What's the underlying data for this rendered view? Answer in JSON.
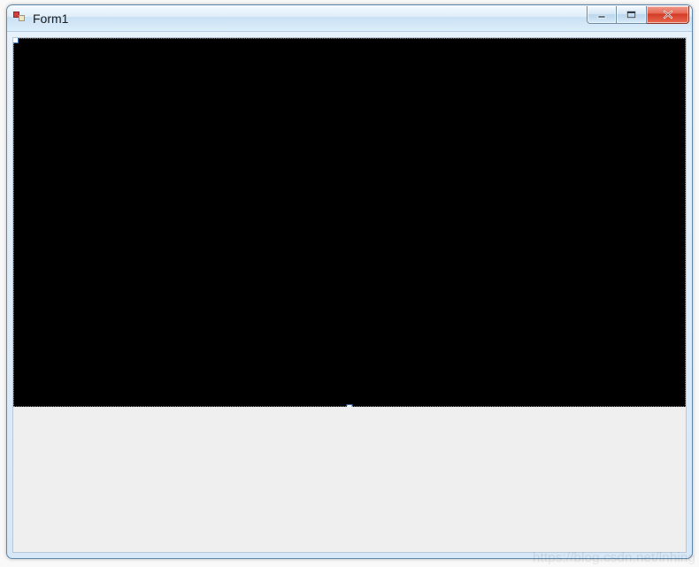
{
  "window": {
    "title": "Form1"
  },
  "titlebar": {
    "buttons": {
      "minimize": "Minimize",
      "maximize": "Maximize",
      "close": "Close"
    }
  },
  "designer": {
    "top_panel_bg": "#000000",
    "bottom_panel_bg": "#efefef"
  },
  "watermark": "https://blog.csdn.net/lnhing"
}
